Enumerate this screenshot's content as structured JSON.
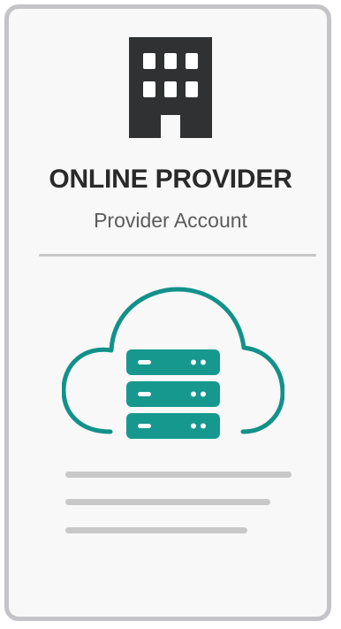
{
  "card": {
    "title": "ONLINE PROVIDER",
    "subtitle": "Provider Account"
  },
  "icons": {
    "top": "office-building-icon",
    "middle": "cloud-server-icon"
  },
  "colors": {
    "building": "#2f3133",
    "cloud": "#12918a",
    "server": "#16988f",
    "text_dark": "#2a2a2a",
    "text_muted": "#5c5c5c",
    "divider": "#c7c7c7",
    "border": "#c4c4c8"
  }
}
